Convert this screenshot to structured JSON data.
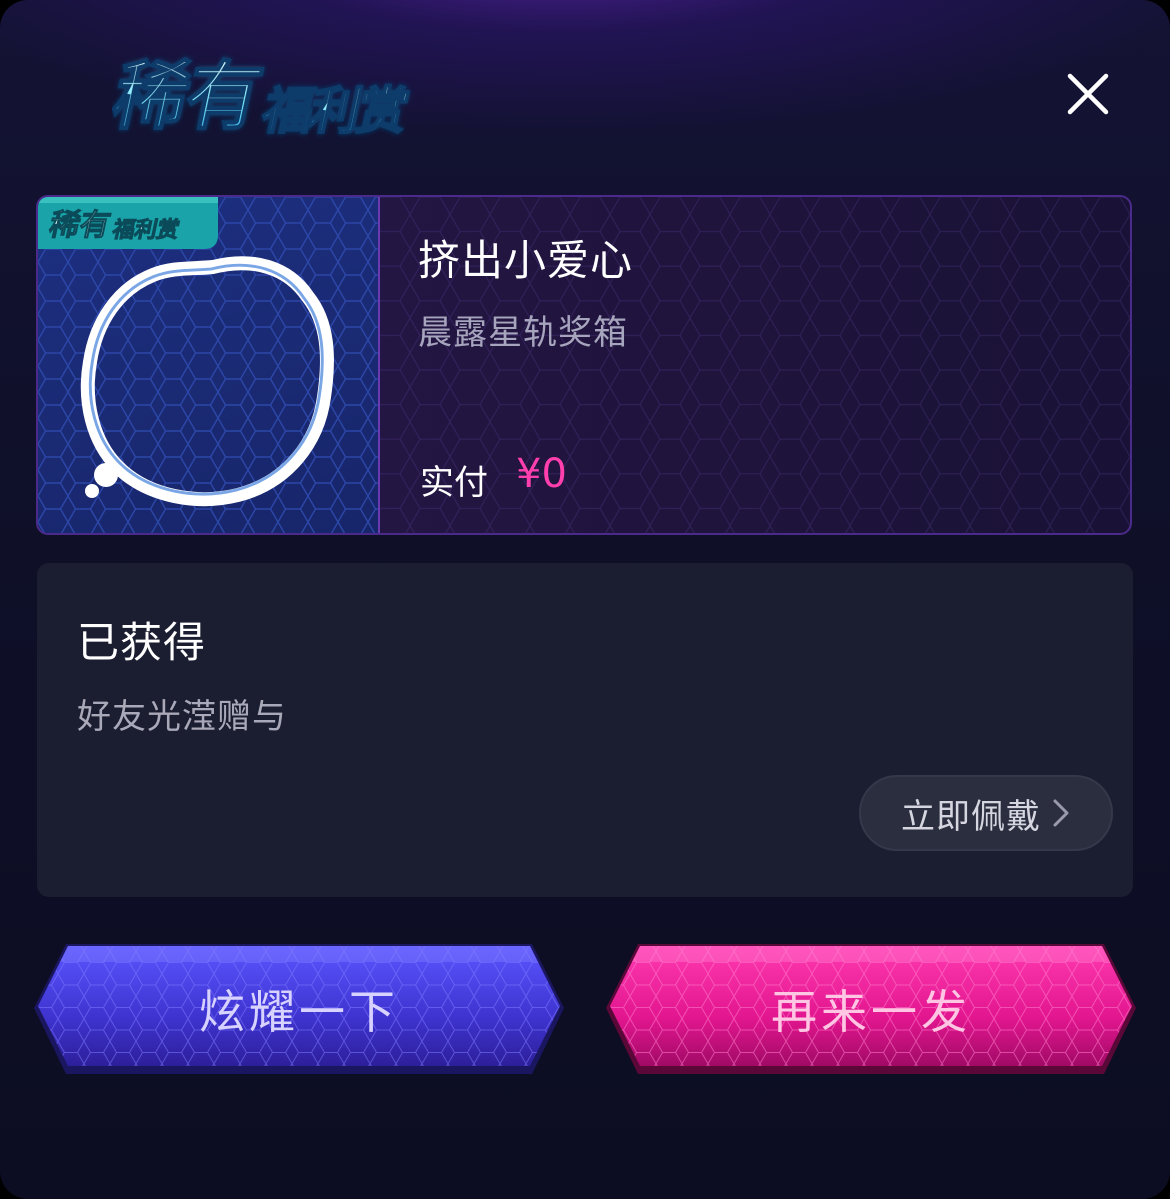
{
  "header": {
    "logo_text": "稀有福利赏",
    "close_icon": "close-icon"
  },
  "item": {
    "badge_text": "稀有福利赏",
    "name": "挤出小爱心",
    "source": "晨露星轨奖箱",
    "paid_label": "实付",
    "paid_value": "¥0",
    "thumbnail": "bubble-frame-icon"
  },
  "obtained": {
    "title": "已获得",
    "description": "好友光滢赠与",
    "wear_button_label": "立即佩戴",
    "wear_button_icon": "chevron-right-icon"
  },
  "actions": {
    "show_off_label": "炫耀一下",
    "again_label": "再来一发"
  },
  "colors": {
    "accent_pink": "#ff3fae",
    "button_purple": "#4a3fe0",
    "button_pink": "#ee1a95",
    "logo_cyan": "#6fe8ff"
  }
}
